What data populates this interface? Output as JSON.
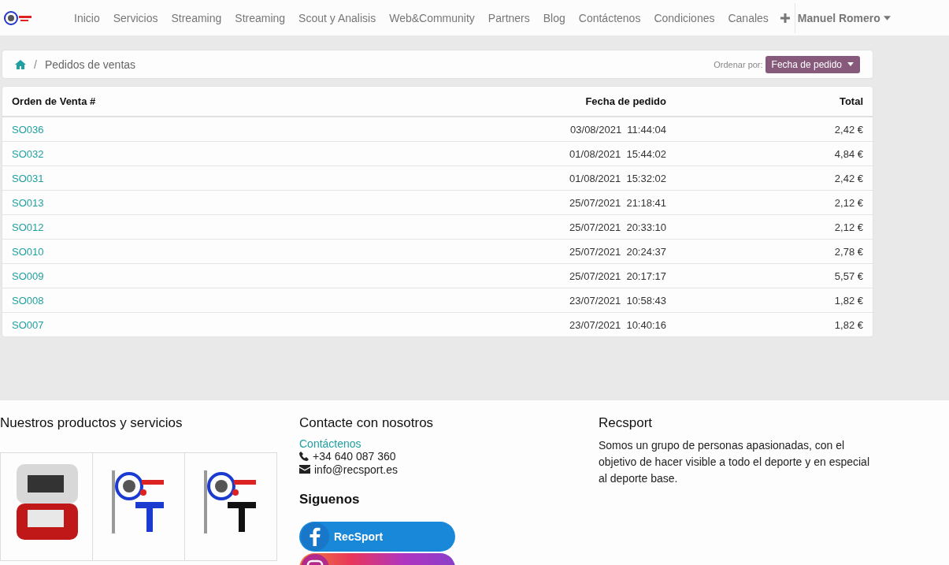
{
  "navbar": {
    "items": [
      "Inicio",
      "Servicios",
      "Streaming",
      "Streaming",
      "Scout y Analisis",
      "Web&Community",
      "Partners",
      "Blog",
      "Contáctenos",
      "Condiciones",
      "Canales"
    ],
    "user": "Manuel Romero"
  },
  "breadcrumb": {
    "separator": "/",
    "current": "Pedidos de ventas"
  },
  "sort": {
    "label": "Ordenar por:",
    "value": "Fecha de pedido"
  },
  "table": {
    "columns": [
      "Orden de Venta #",
      "Fecha de pedido",
      "Total"
    ],
    "rows": [
      {
        "order": "SO036",
        "date": "03/08/2021",
        "time": "11:44:04",
        "total": "2,42 €"
      },
      {
        "order": "SO032",
        "date": "01/08/2021",
        "time": "15:44:02",
        "total": "4,84 €"
      },
      {
        "order": "SO031",
        "date": "01/08/2021",
        "time": "15:32:02",
        "total": "2,42 €"
      },
      {
        "order": "SO013",
        "date": "25/07/2021",
        "time": "21:18:41",
        "total": "2,12 €"
      },
      {
        "order": "SO012",
        "date": "25/07/2021",
        "time": "20:33:10",
        "total": "2,12 €"
      },
      {
        "order": "SO010",
        "date": "25/07/2021",
        "time": "20:24:37",
        "total": "2,78 €"
      },
      {
        "order": "SO009",
        "date": "25/07/2021",
        "time": "20:17:17",
        "total": "5,57 €"
      },
      {
        "order": "SO008",
        "date": "23/07/2021",
        "time": "10:58:43",
        "total": "1,82 €"
      },
      {
        "order": "SO007",
        "date": "23/07/2021",
        "time": "10:40:16",
        "total": "1,82 €"
      }
    ]
  },
  "footer": {
    "products": {
      "title": "Nuestros productos y servicios"
    },
    "contact": {
      "title": "Contacte con nosotros",
      "link": "Contáctenos",
      "phone": "+34 640 087 360",
      "email": "info@recsport.es"
    },
    "follow": {
      "title": "Siguenos",
      "buttons": [
        {
          "kind": "facebook",
          "label": "RecSport"
        },
        {
          "kind": "instagram"
        }
      ]
    },
    "about": {
      "title": "Recsport",
      "text": "Somos un grupo de personas apasionadas, con el objetivo de hacer visible a todo el deporte y en especial al deporte base."
    }
  }
}
